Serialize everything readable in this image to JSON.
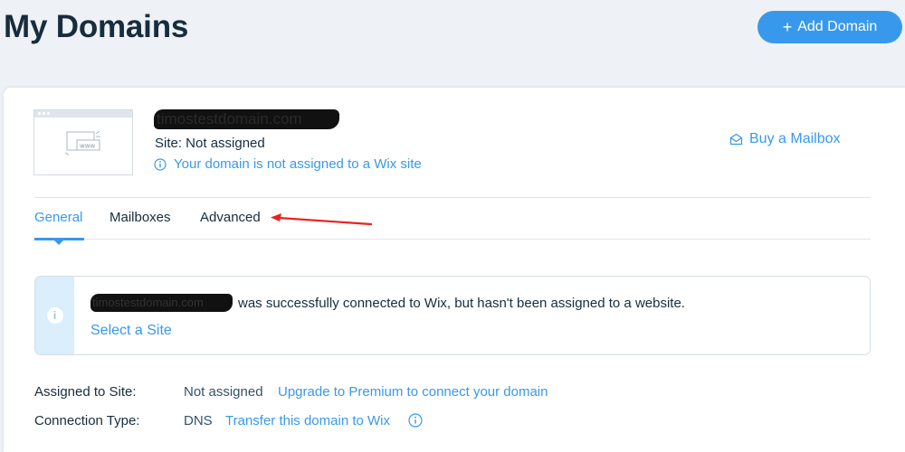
{
  "header": {
    "title": "My Domains",
    "add_domain_label": "Add Domain"
  },
  "domain": {
    "name": "timostestdomain.com",
    "site_status": "Site: Not assigned",
    "warning": "Your domain is not assigned to a Wix site",
    "buy_mailbox": "Buy a Mailbox",
    "thumbnail_text": "www"
  },
  "tabs": [
    {
      "label": "General",
      "active": true
    },
    {
      "label": "Mailboxes",
      "active": false
    },
    {
      "label": "Advanced",
      "active": false
    }
  ],
  "notice": {
    "domain": "timostestdomain.com",
    "message": "was successfully connected to Wix, but hasn't been assigned to a website.",
    "action": "Select a Site"
  },
  "details": {
    "assigned_label": "Assigned to Site:",
    "assigned_value": "Not assigned",
    "assigned_link": "Upgrade to Premium to connect your domain",
    "connection_label": "Connection Type:",
    "connection_value": "DNS",
    "connection_link": "Transfer this domain to Wix"
  },
  "colors": {
    "accent": "#3899ec",
    "text": "#162d3d",
    "notice_bg": "#daeefc",
    "annotation": "#e8231d"
  },
  "icons": {
    "add": "plus-icon",
    "info": "info-icon",
    "mail": "mail-icon",
    "annotation": "red-arrow"
  }
}
